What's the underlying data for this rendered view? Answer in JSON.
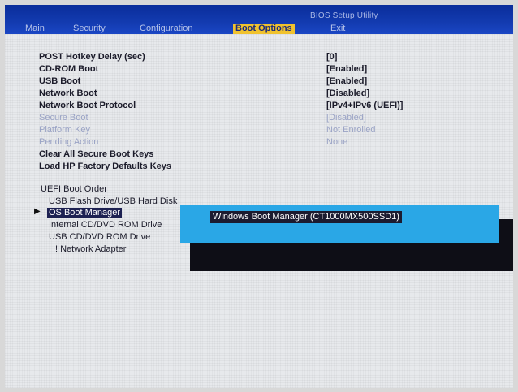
{
  "header": {
    "utility_title": "BIOS Setup Utility",
    "tabs": [
      "Main",
      "Security",
      "Configuration",
      "Boot Options",
      "Exit"
    ],
    "active_tab": "Boot Options"
  },
  "settings": [
    {
      "label": "POST Hotkey Delay (sec)",
      "value": "[0]",
      "enabled": true
    },
    {
      "label": "CD-ROM Boot",
      "value": "[Enabled]",
      "enabled": true
    },
    {
      "label": "USB Boot",
      "value": "[Enabled]",
      "enabled": true
    },
    {
      "label": "Network Boot",
      "value": "[Disabled]",
      "enabled": true
    },
    {
      "label": "Network Boot Protocol",
      "value": "[IPv4+IPv6 (UEFI)]",
      "enabled": true
    },
    {
      "label": "Secure Boot",
      "value": "[Disabled]",
      "enabled": false
    },
    {
      "label": "Platform Key",
      "value": "Not Enrolled",
      "enabled": false
    },
    {
      "label": "Pending Action",
      "value": "None",
      "enabled": false
    },
    {
      "label": "Clear All Secure Boot Keys",
      "value": "",
      "enabled": true
    },
    {
      "label": "Load HP Factory Defaults Keys",
      "value": "",
      "enabled": true
    }
  ],
  "boot_order": {
    "title": "UEFI Boot Order",
    "items": [
      "USB Flash Drive/USB Hard Disk",
      "OS Boot Manager",
      "Internal CD/DVD ROM Drive",
      "USB CD/DVD ROM Drive",
      "! Network Adapter"
    ],
    "selected_index": 1
  },
  "popup": {
    "item": "Windows Boot Manager (CT1000MX500SSD1)"
  },
  "colors": {
    "menubar": "#133bb0",
    "active_tab": "#f0c22e",
    "popup": "#2aa7e6",
    "selection": "#1d2152"
  }
}
